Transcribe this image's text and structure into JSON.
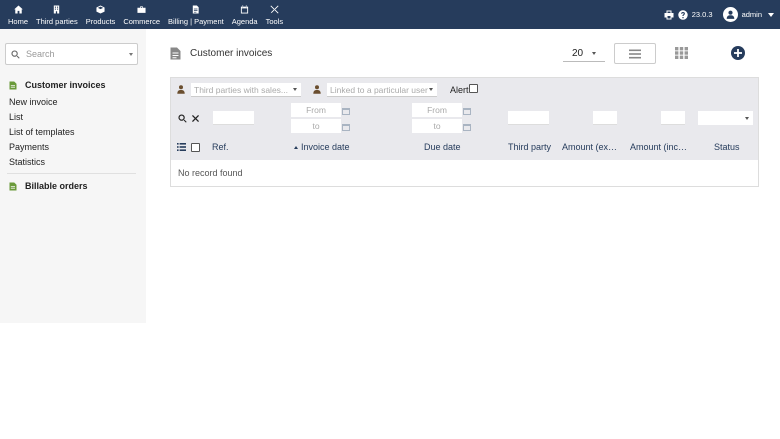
{
  "topbar": {
    "menu": [
      {
        "label": "Home",
        "icon": "home-icon"
      },
      {
        "label": "Third parties",
        "icon": "building-icon"
      },
      {
        "label": "Products",
        "icon": "cube-icon"
      },
      {
        "label": "Commerce",
        "icon": "briefcase-icon"
      },
      {
        "label": "Billing | Payment",
        "icon": "invoice-icon"
      },
      {
        "label": "Agenda",
        "icon": "calendar-icon"
      },
      {
        "label": "Tools",
        "icon": "tools-icon"
      }
    ],
    "version": "23.0.3",
    "username": "admin"
  },
  "sidebar": {
    "search_placeholder": "Search",
    "section1_title": "Customer invoices",
    "links": [
      "New invoice",
      "List",
      "List of templates",
      "Payments",
      "Statistics"
    ],
    "section2_title": "Billable orders"
  },
  "main": {
    "title": "Customer invoices",
    "limit": "20",
    "filters": {
      "sales_rep_placeholder": "Third parties with sales...",
      "linked_user_placeholder": "Linked to a particular user",
      "alert_label": "Alert",
      "from_label": "From",
      "to_label": "to"
    },
    "columns": {
      "ref": "Ref.",
      "invoice_date": "Invoice date",
      "due_date": "Due date",
      "third_party": "Third party",
      "amount_excl": "Amount (excl. tax)",
      "amount_incl": "Amount (inc. tax)",
      "status": "Status"
    },
    "empty_message": "No record found"
  },
  "colors": {
    "topbar": "#263c5c",
    "sidebar": "#f6f6f6",
    "filter_bg": "#e9e9ed",
    "link": "#263c5c",
    "module_icon": "#6a9a3a"
  }
}
